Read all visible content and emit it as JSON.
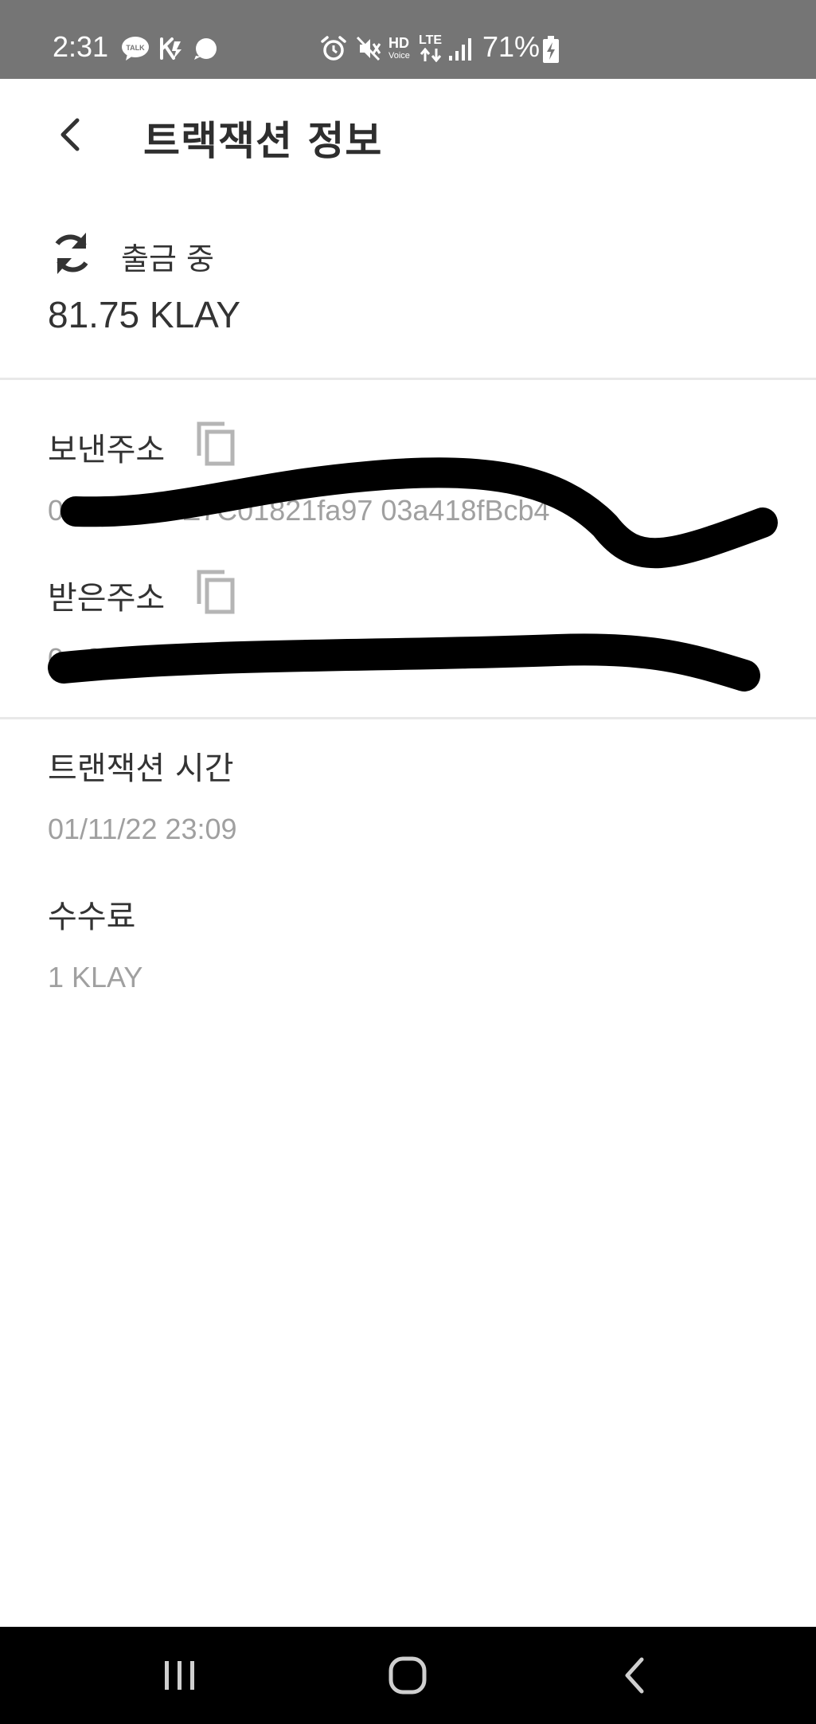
{
  "status_bar": {
    "time": "2:31",
    "talk_badge": "TALK",
    "hd_label": "HD",
    "voice_label": "Voice",
    "lte_label": "LTE",
    "battery": "71%"
  },
  "header": {
    "title": "트랙잭션 정보"
  },
  "summary": {
    "status": "출금 중",
    "amount": "81.75 KLAY"
  },
  "fields": {
    "sender": {
      "label": "보낸주소",
      "value": "0x                    383530E7C01821fa97              03a418fBcb4"
    },
    "receiver": {
      "label": "받은주소",
      "value": "0x                      01C27146D0a2F036824E              1c5"
    },
    "time": {
      "label": "트랜잭션 시간",
      "value": "01/11/22 23:09"
    },
    "fee": {
      "label": "수수료",
      "value": "1 KLAY"
    }
  },
  "colors": {
    "status_bar": "#757575",
    "text_primary": "#333333",
    "text_secondary": "#a0a0a0",
    "divider": "#e8e8e8",
    "nav_bar": "#000000"
  }
}
